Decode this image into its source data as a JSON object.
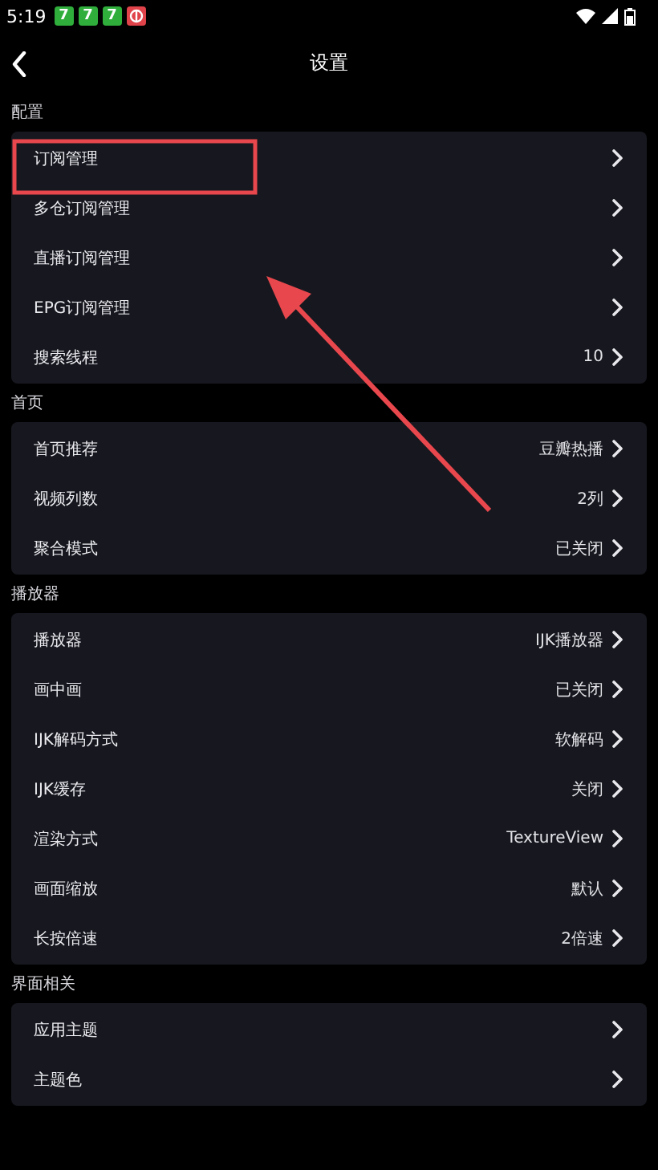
{
  "status_bar": {
    "time": "5:19",
    "badges": [
      {
        "text": "7",
        "color": "#2fae3c"
      },
      {
        "text": "7",
        "color": "#2fae3c"
      },
      {
        "text": "7",
        "color": "#2fae3c"
      }
    ]
  },
  "header": {
    "title": "设置"
  },
  "sections": [
    {
      "title": "配置",
      "items": [
        {
          "label": "订阅管理"
        },
        {
          "label": "多仓订阅管理"
        },
        {
          "label": "直播订阅管理"
        },
        {
          "label": "EPG订阅管理"
        },
        {
          "label": "搜索线程",
          "value": "10"
        }
      ]
    },
    {
      "title": "首页",
      "items": [
        {
          "label": "首页推荐",
          "value": "豆瓣热播"
        },
        {
          "label": "视频列数",
          "value": "2列"
        },
        {
          "label": "聚合模式",
          "value": "已关闭"
        }
      ]
    },
    {
      "title": "播放器",
      "items": [
        {
          "label": "播放器",
          "value": "IJK播放器"
        },
        {
          "label": "画中画",
          "value": "已关闭"
        },
        {
          "label": "IJK解码方式",
          "value": "软解码"
        },
        {
          "label": "IJK缓存",
          "value": "关闭"
        },
        {
          "label": "渲染方式",
          "value": "TextureView"
        },
        {
          "label": "画面缩放",
          "value": "默认"
        },
        {
          "label": "长按倍速",
          "value": "2倍速"
        }
      ]
    },
    {
      "title": "界面相关",
      "items": [
        {
          "label": "应用主题"
        },
        {
          "label": "主题色"
        }
      ]
    }
  ]
}
